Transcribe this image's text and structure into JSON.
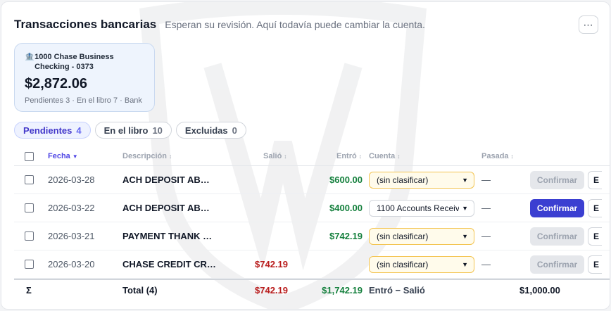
{
  "header": {
    "title": "Transacciones bancarias",
    "subtitle": "Esperan su revisión. Aquí todavía puede cambiar la cuenta.",
    "menu_icon": "⋯"
  },
  "account": {
    "icon": "🏦",
    "name": "1000 Chase Business Checking - 0373",
    "balance": "$2,872.06",
    "meta": "Pendientes 3 · En el libro 7 · Bank"
  },
  "tabs": [
    {
      "label": "Pendientes",
      "count": "4",
      "active": true
    },
    {
      "label": "En el libro",
      "count": "10",
      "active": false
    },
    {
      "label": "Excluidas",
      "count": "0",
      "active": false
    }
  ],
  "columns": {
    "date": "Fecha",
    "date_arrow": "▼",
    "description": "Descripción",
    "description_arrow": "↕",
    "out": "Salió",
    "out_arrow": "↕",
    "in": "Entró",
    "in_arrow": "↕",
    "account": "Cuenta",
    "account_arrow": "↕",
    "passed": "Pasada",
    "passed_arrow": "↕"
  },
  "rows": [
    {
      "date": "2026-03-28",
      "description": "ACH DEPOSIT AB…",
      "out": "",
      "in": "$600.00",
      "account": "(sin clasificar)",
      "passed": "—",
      "confirm": "Confirmar",
      "extra": "E"
    },
    {
      "date": "2026-03-22",
      "description": "ACH DEPOSIT AB…",
      "out": "",
      "in": "$400.00",
      "account": "1100 Accounts Receiv",
      "passed": "—",
      "confirm": "Confirmar",
      "extra": "E"
    },
    {
      "date": "2026-03-21",
      "description": "PAYMENT THANK …",
      "out": "",
      "in": "$742.19",
      "account": "(sin clasificar)",
      "passed": "—",
      "confirm": "Confirmar",
      "extra": "E"
    },
    {
      "date": "2026-03-20",
      "description": "CHASE CREDIT CR…",
      "out": "$742.19",
      "in": "",
      "account": "(sin clasificar)",
      "passed": "—",
      "confirm": "Confirmar",
      "extra": "E"
    }
  ],
  "totals": {
    "sigma": "Σ",
    "label": "Total (4)",
    "out": "$742.19",
    "in": "$1,742.19",
    "net_label": "Entró − Salió",
    "net": "$1,000.00"
  },
  "colors": {
    "accent": "#3b3fd1",
    "in_green": "#15803d",
    "out_red": "#b91c1c",
    "warn_border": "#f3c451"
  }
}
